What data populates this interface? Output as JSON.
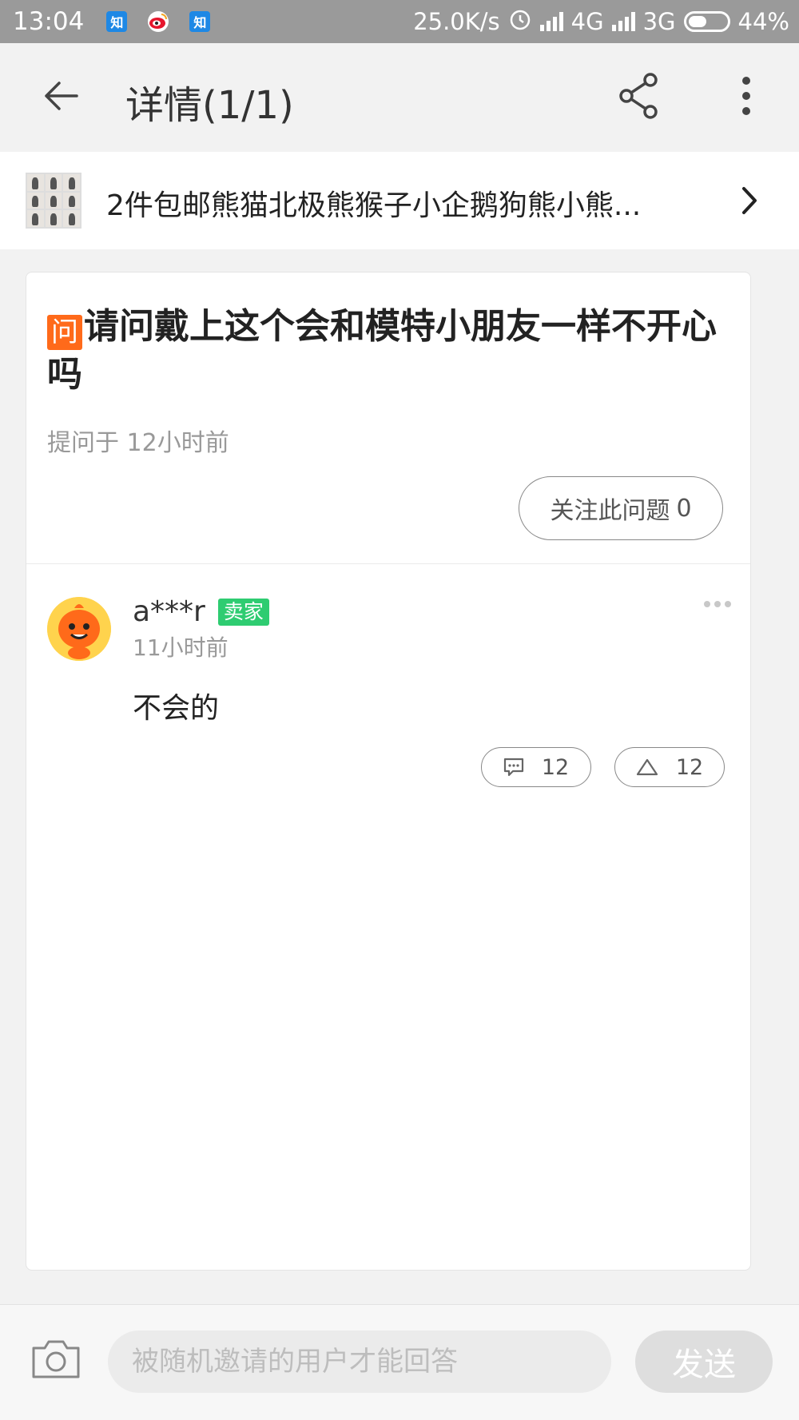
{
  "status_bar": {
    "time": "13:04",
    "apps": [
      {
        "icon": "zhihu-icon",
        "label": "知"
      },
      {
        "icon": "weibo-icon",
        "label": "微"
      },
      {
        "icon": "zhihu-icon",
        "label": "知"
      }
    ],
    "net_speed": "25.0K/s",
    "network_1": "4G",
    "network_2": "3G",
    "battery": "44%"
  },
  "header": {
    "title": "详情(1/1)",
    "back_icon": "back-arrow-icon",
    "share_icon": "share-icon",
    "more_icon": "more-vertical-icon"
  },
  "product": {
    "title": "2件包邮熊猫北极熊猴子小企鹅狗熊小熊..."
  },
  "question": {
    "badge": "问",
    "title": "请问戴上这个会和模特小朋友一样不开心吗",
    "time": "提问于 12小时前",
    "follow_label": "关注此问题",
    "follow_count": "0"
  },
  "answer": {
    "user": "a***r",
    "tag": "卖家",
    "time": "11小时前",
    "text": "不会的",
    "reply_count": "12",
    "like_count": "12"
  },
  "bottom": {
    "input_placeholder": "被随机邀请的用户才能回答",
    "send_label": "发送"
  },
  "colors": {
    "accent_orange": "#ff6a1a",
    "seller_green": "#2ecc71",
    "status_bar": "#9a9a9a"
  }
}
